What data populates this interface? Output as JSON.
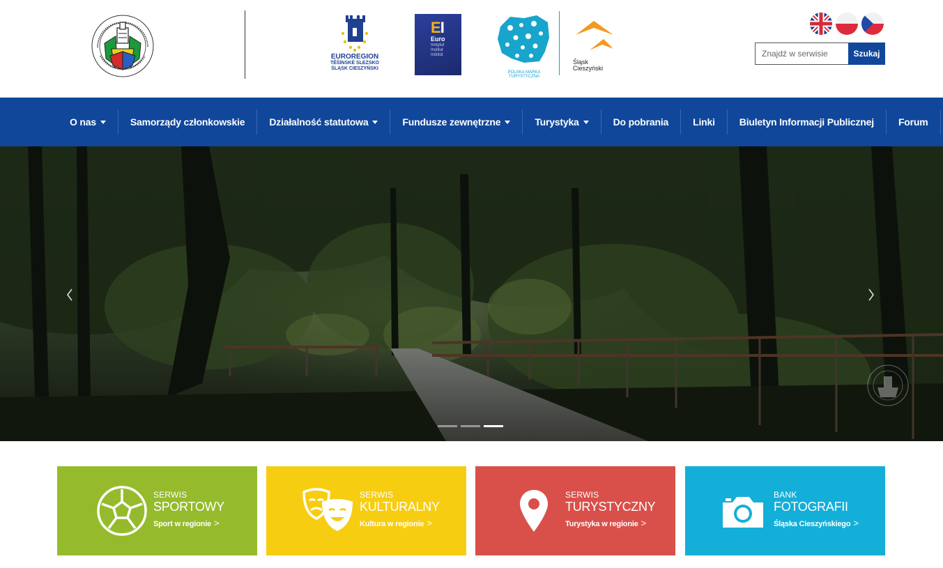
{
  "header": {
    "partners": {
      "euroregion": {
        "title": "EUROREGION",
        "line1": "TĚŠÍNSKÉ SLEZSKO",
        "line2": "ŚLĄSK CIESZYŃSKI"
      },
      "ei": {
        "mark_e": "E",
        "mark_i": "I",
        "euro": "Euro",
        "line1": "Instytut",
        "line2": "Institut",
        "line3": "Inštitút"
      },
      "pmt": {
        "caption": "POLSKA MARKA TURYSTYCZNA"
      },
      "slask": {
        "line1": "Śląsk",
        "line2": "Cieszyński"
      }
    },
    "search": {
      "placeholder": "Znajdź w serwisie",
      "button_label": "Szukaj"
    },
    "colors": {
      "nav_blue": "#10479b",
      "sport": "#95bb2d",
      "culture": "#f7cd12",
      "tourism": "#d9504a",
      "photo": "#13afd8"
    }
  },
  "nav": {
    "items": [
      {
        "label": "O nas",
        "dropdown": true
      },
      {
        "label": "Samorządy członkowskie",
        "dropdown": false
      },
      {
        "label": "Działalność statutowa",
        "dropdown": true
      },
      {
        "label": "Fundusze zewnętrzne",
        "dropdown": true
      },
      {
        "label": "Turystyka",
        "dropdown": true
      },
      {
        "label": "Do pobrania",
        "dropdown": false
      },
      {
        "label": "Linki",
        "dropdown": false
      },
      {
        "label": "Biuletyn Informacji Publicznej",
        "dropdown": false
      },
      {
        "label": "Forum",
        "dropdown": false
      }
    ]
  },
  "hero": {
    "prev_icon": "chevron-left-icon",
    "next_icon": "chevron-right-icon",
    "active_slide": 3
  },
  "tiles": [
    {
      "small": "SERWIS",
      "big": "SPORTOWY",
      "link": "Sport w regionie",
      "chev": ">",
      "icon": "football-icon"
    },
    {
      "small": "SERWIS",
      "big": "KULTURALNY",
      "link": "Kultura w regionie",
      "chev": ">",
      "icon": "theater-masks-icon"
    },
    {
      "small": "SERWIS",
      "big": "TURYSTYCZNY",
      "link": "Turystyka w regionie",
      "chev": ">",
      "icon": "map-pin-icon"
    },
    {
      "small": "BANK",
      "big": "FOTOGRAFII",
      "link": "Śląska Cieszyńskiego",
      "chev": ">",
      "icon": "camera-icon"
    }
  ]
}
